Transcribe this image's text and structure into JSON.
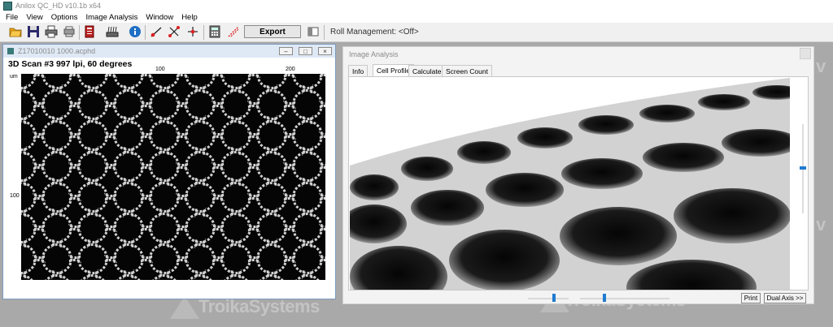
{
  "app": {
    "title": "Anilox QC_HD v10.1b x64"
  },
  "menu": [
    "File",
    "View",
    "Options",
    "Image Analysis",
    "Window",
    "Help"
  ],
  "toolbar": {
    "export_label": "Export",
    "roll_management": "Roll Management: <Off>"
  },
  "scan_window": {
    "title": "Z17010010 1000.acphd",
    "heading": "3D Scan #3 997 lpi, 60 degrees",
    "unit_label": "um",
    "x_ticks": [
      "100",
      "200"
    ],
    "y_ticks": [
      "100"
    ]
  },
  "analysis_window": {
    "title": "Image Analysis",
    "tabs": [
      "Info",
      "Cell Profile",
      "Calculate",
      "Screen Count"
    ],
    "active_tab": "Cell Profile",
    "print_label": "Print",
    "dual_axis_label": "Dual Axis >>",
    "sliders": {
      "vertical": 0.5,
      "h1": 0.6,
      "h2": 0.25
    }
  },
  "watermark": {
    "text": "TroikaSystems"
  },
  "colors": {
    "desktop": "#a9a9a9",
    "accent": "#1f7bd1"
  }
}
